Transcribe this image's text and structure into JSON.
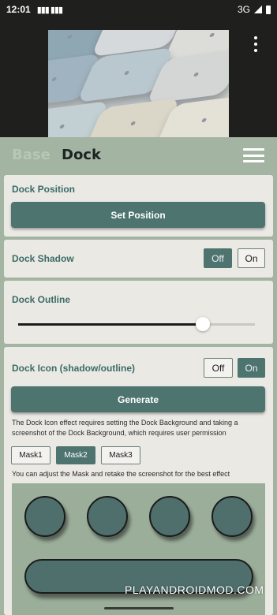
{
  "status_bar": {
    "time": "12:01",
    "network": "3G",
    "icons": [
      "signal-icon",
      "wifi-icon",
      "battery-icon"
    ]
  },
  "tabs": {
    "base_label": "Base",
    "dock_label": "Dock",
    "active": "Dock"
  },
  "dock_position": {
    "title": "Dock Position",
    "button_label": "Set Position"
  },
  "dock_shadow": {
    "title": "Dock Shadow",
    "off_label": "Off",
    "on_label": "On",
    "selected": "Off"
  },
  "dock_outline": {
    "title": "Dock Outline",
    "slider_value": 0.78
  },
  "dock_icon": {
    "title": "Dock Icon (shadow/outline)",
    "off_label": "Off",
    "on_label": "On",
    "selected": "On",
    "generate_label": "Generate",
    "note1": "The Dock Icon effect requires setting the Dock Background and taking a screenshot of the Dock Background, which requires user permission",
    "masks": [
      "Mask1",
      "Mask2",
      "Mask3"
    ],
    "selected_mask": "Mask2",
    "note2": "You can adjust the Mask and retake the screenshot for the best effect"
  },
  "watermark": "PLAYANDROIDMOD.COM",
  "colors": {
    "accent": "#4e7470",
    "panel_bg": "#a3b4a2",
    "card_bg": "#ebe9e4",
    "title_text": "#3b6b66"
  }
}
